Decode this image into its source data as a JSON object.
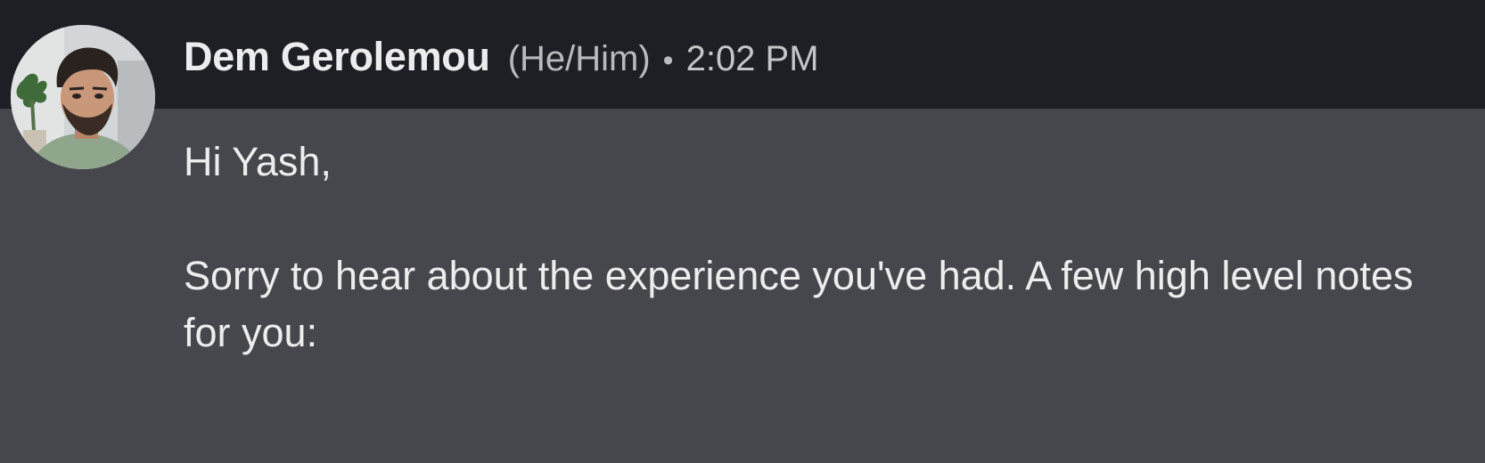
{
  "message": {
    "sender_name": "Dem Gerolemou",
    "pronouns": "(He/Him)",
    "separator": "•",
    "timestamp": "2:02 PM",
    "greeting": "Hi Yash,",
    "paragraph": "Sorry to hear about the experience you've had. A few high level notes for you:"
  },
  "avatar": {
    "icon": "profile-photo",
    "colors": {
      "background": "#cfd3d6",
      "shirt": "#8fa58c",
      "skin": "#c9977a",
      "hair": "#2a221e",
      "plant": "#3f6b3a"
    }
  },
  "colors": {
    "header_background": "#1d1f24",
    "body_background": "#46474c",
    "text_primary": "#ededee",
    "text_secondary": "#b9babd"
  }
}
